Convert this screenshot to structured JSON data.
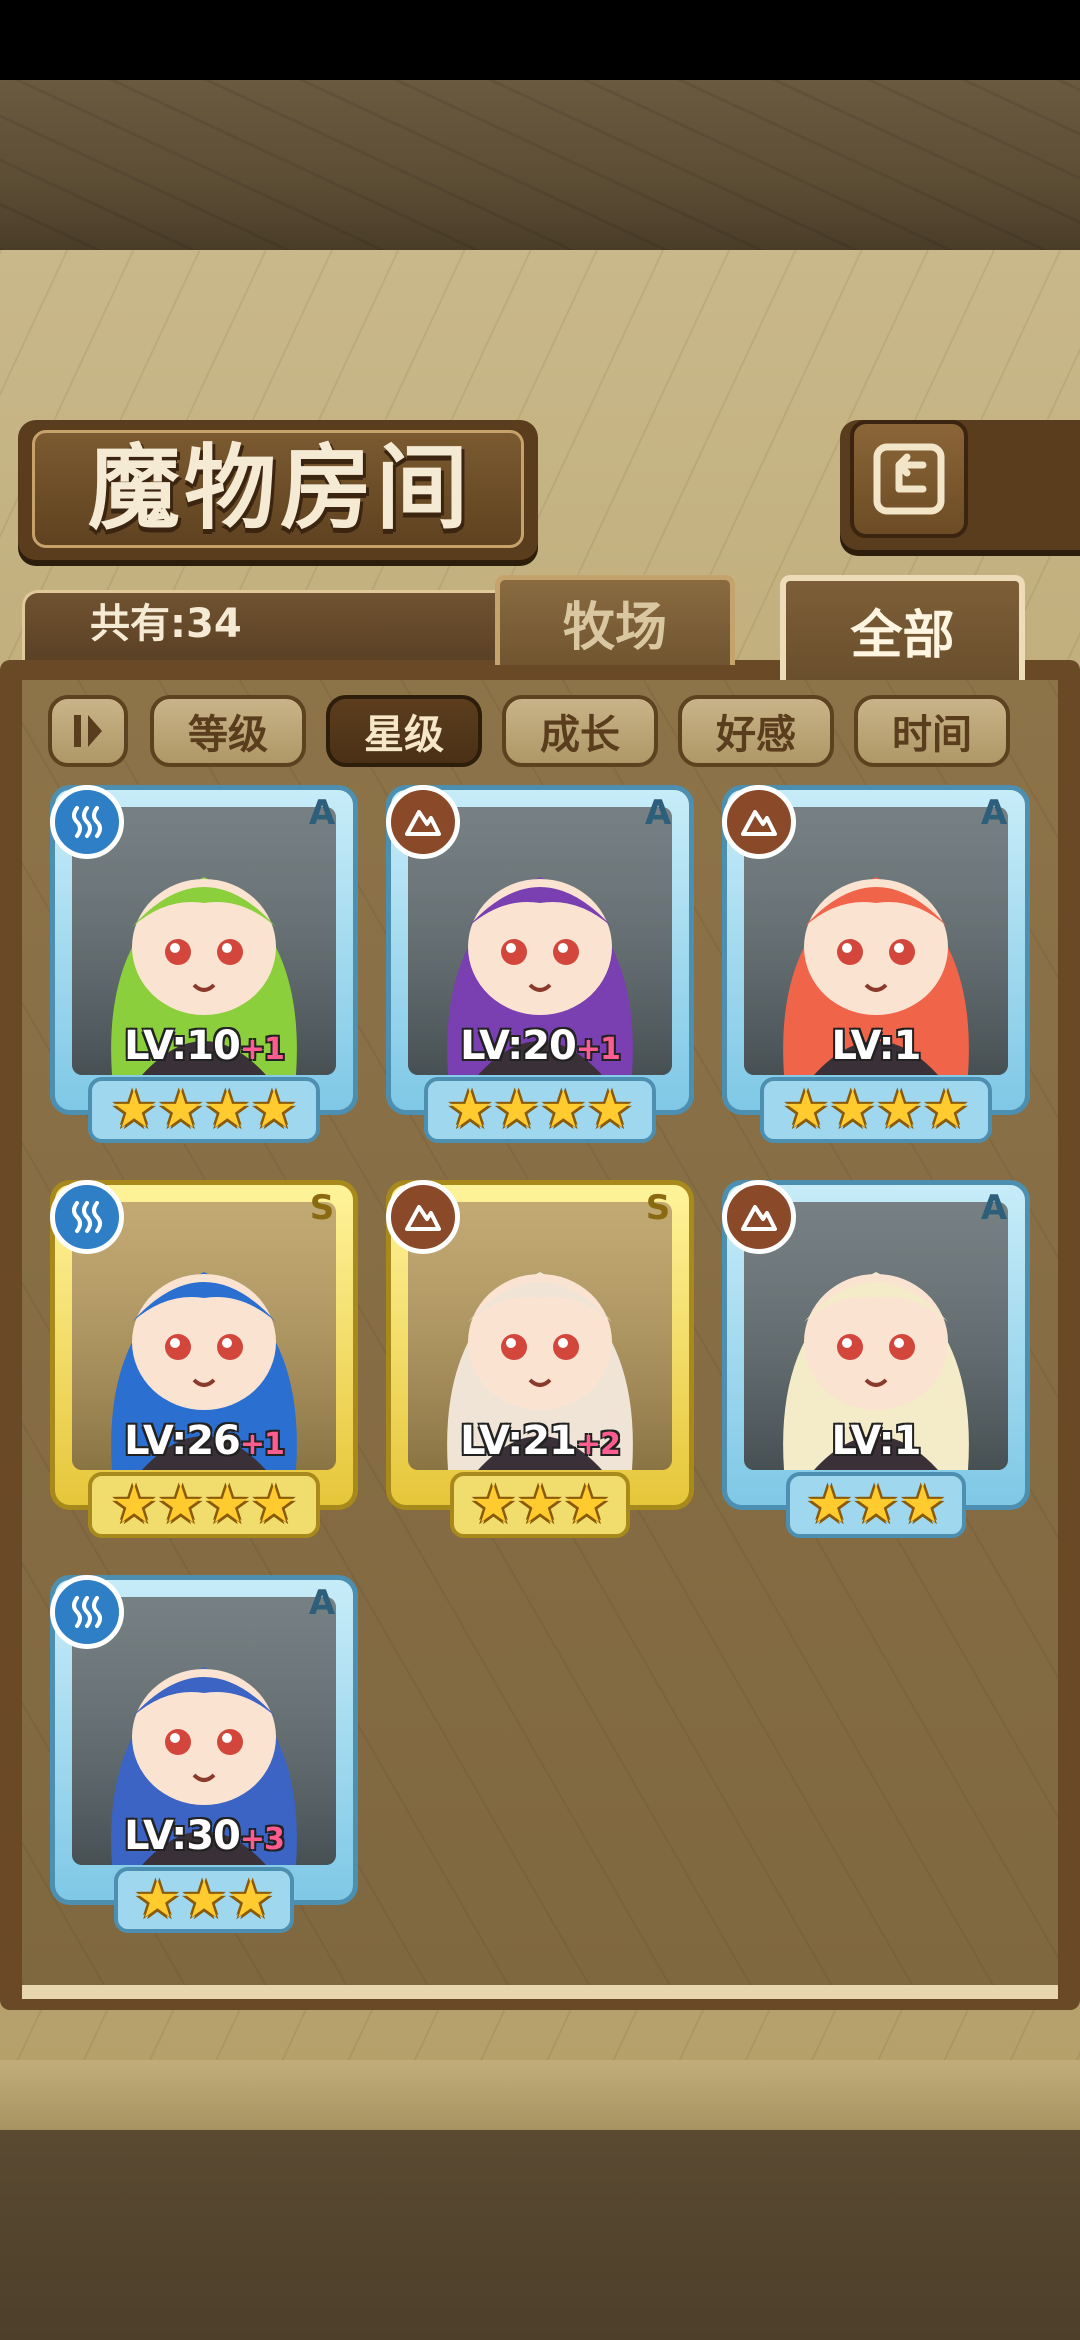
{
  "header": {
    "title": "魔物房间"
  },
  "summary": {
    "count_label": "共有:34"
  },
  "tabs": [
    {
      "label": "牧场",
      "active": false
    },
    {
      "label": "全部",
      "active": true
    }
  ],
  "filters": [
    {
      "label": "等级",
      "active": false
    },
    {
      "label": "星级",
      "active": true
    },
    {
      "label": "成长",
      "active": false
    },
    {
      "label": "好感",
      "active": false
    },
    {
      "label": "时间",
      "active": false
    }
  ],
  "monsters": [
    {
      "element": "water-icon",
      "rank": "A",
      "frame": "blue",
      "level": "LV:10",
      "bonus": "+1",
      "stars": 4,
      "hair_color": "#8ccf3c"
    },
    {
      "element": "earth-icon",
      "rank": "A",
      "frame": "blue",
      "level": "LV:20",
      "bonus": "+1",
      "stars": 4,
      "hair_color": "#7a3fb0"
    },
    {
      "element": "earth-icon",
      "rank": "A",
      "frame": "blue",
      "level": "LV:1",
      "bonus": "",
      "stars": 4,
      "hair_color": "#f0644a"
    },
    {
      "element": "water-icon",
      "rank": "S",
      "frame": "gold",
      "level": "LV:26",
      "bonus": "+1",
      "stars": 4,
      "hair_color": "#2b6fd1"
    },
    {
      "element": "earth-icon",
      "rank": "S",
      "frame": "gold",
      "level": "LV:21",
      "bonus": "+2",
      "stars": 3,
      "hair_color": "#efe4d6"
    },
    {
      "element": "earth-icon",
      "rank": "A",
      "frame": "blue",
      "level": "LV:1",
      "bonus": "",
      "stars": 3,
      "hair_color": "#f4ebc8"
    },
    {
      "element": "water-icon",
      "rank": "A",
      "frame": "blue",
      "level": "LV:30",
      "bonus": "+3",
      "stars": 3,
      "hair_color": "#3b64c4"
    }
  ],
  "colors": {
    "water": "#2f7fc6",
    "earth": "#8a4a2a",
    "star": "#ffcb2e",
    "bonus": "#ff5c8f"
  }
}
